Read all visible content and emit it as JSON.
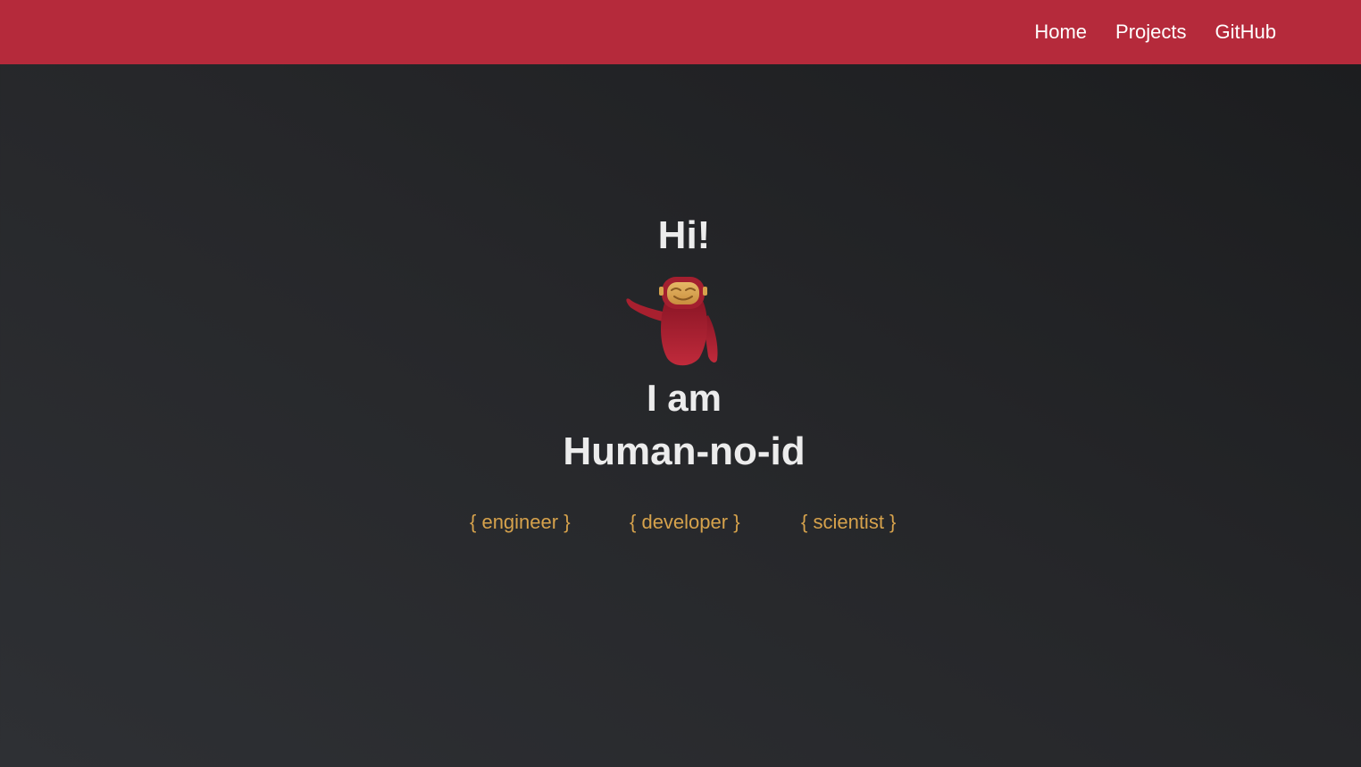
{
  "nav": {
    "links": [
      {
        "label": "Home"
      },
      {
        "label": "Projects"
      },
      {
        "label": "GitHub"
      }
    ]
  },
  "hero": {
    "greeting": "Hi!",
    "mascot": "waving-robot-mascot-icon",
    "intro": "I am",
    "name": "Human-no-id",
    "roles": [
      "{ engineer }",
      "{ developer }",
      "{ scientist }"
    ]
  },
  "colors": {
    "navbar": "#b52a3b",
    "role_text": "#d6a24c",
    "heading_text": "#ececec",
    "background": "#26272a"
  }
}
